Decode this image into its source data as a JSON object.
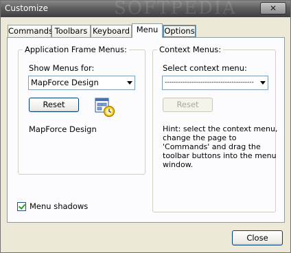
{
  "window": {
    "title": "Customize",
    "close_glyph": "✕",
    "watermark": "SOFTPEDIA"
  },
  "tabs": [
    {
      "label": "Commands"
    },
    {
      "label": "Toolbars"
    },
    {
      "label": "Keyboard"
    },
    {
      "label": "Menu",
      "active": true
    },
    {
      "label": "Options"
    }
  ],
  "app_frame": {
    "legend": "Application Frame Menus:",
    "show_for_label": "Show Menus for:",
    "show_for_value": "MapForce Design",
    "reset_label": "Reset",
    "icon": "menu-animation-icon",
    "current_label": "MapForce Design"
  },
  "context": {
    "legend": "Context Menus:",
    "select_label": "Select context menu:",
    "select_value": "----------------------------------------",
    "reset_label": "Reset",
    "hint": "Hint: select the context menu, change the page to 'Commands' and drag the toolbar buttons into the menu window."
  },
  "menu_shadows": {
    "label": "Menu shadows",
    "checked": true
  },
  "footer": {
    "close_label": "Close"
  }
}
